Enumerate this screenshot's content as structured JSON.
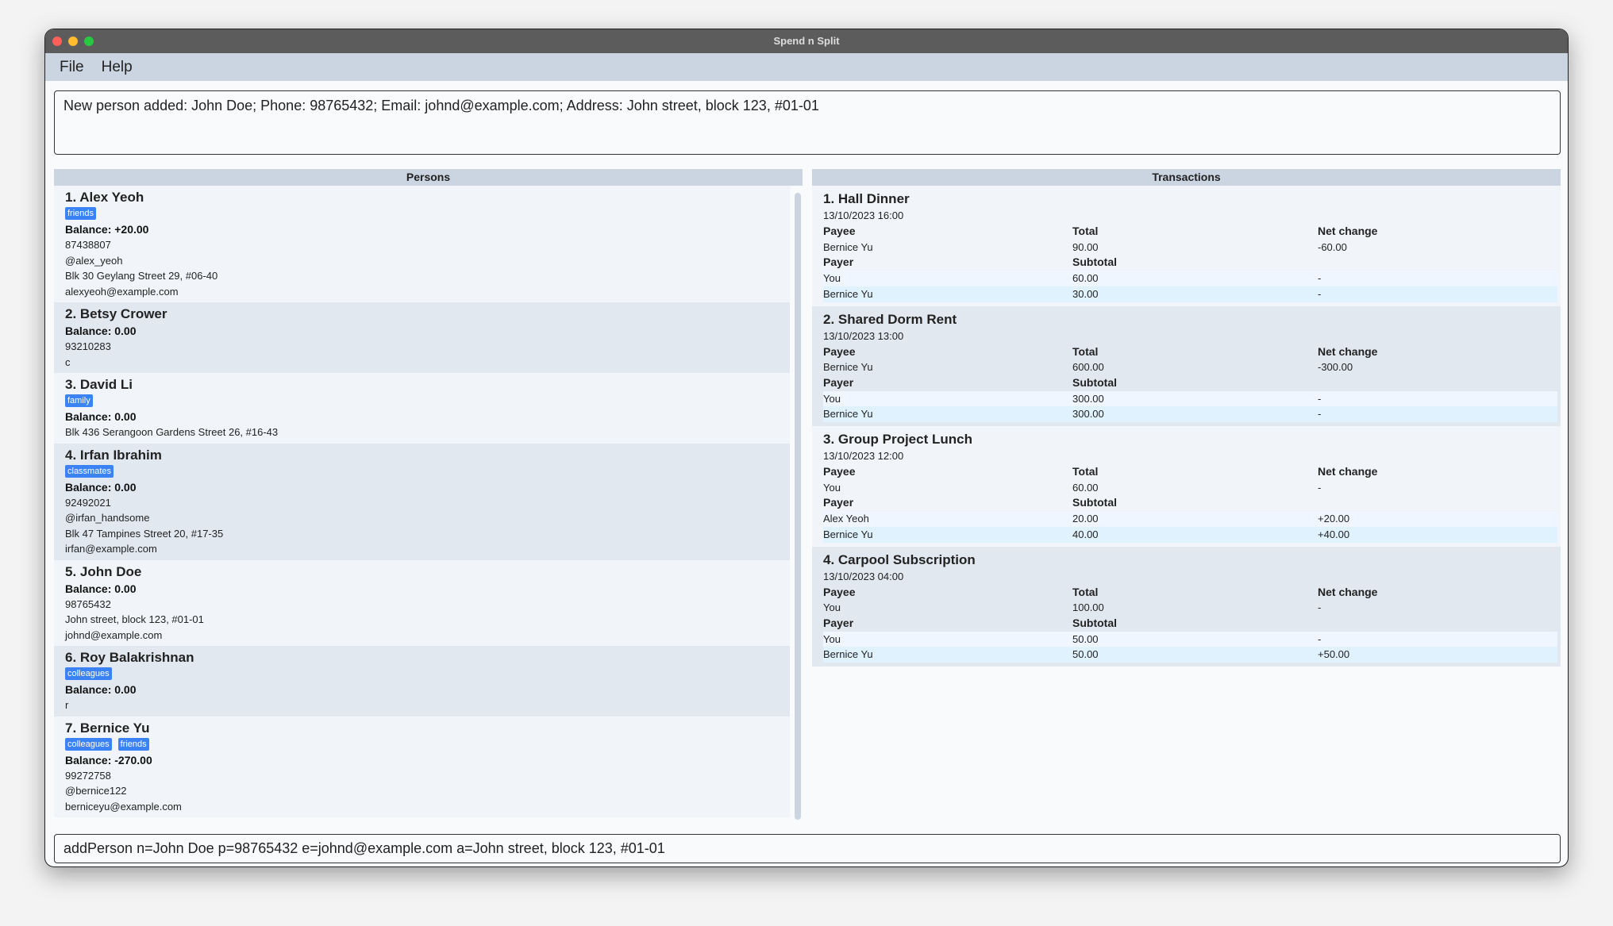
{
  "window": {
    "title": "Spend n Split"
  },
  "menu": [
    "File",
    "Help"
  ],
  "result": "New person added: John Doe; Phone: 98765432; Email: johnd@example.com; Address: John street, block 123, #01-01",
  "persons": {
    "header": "Persons",
    "items": [
      {
        "name": "1.  Alex Yeoh",
        "tags": [
          "friends"
        ],
        "balance": "Balance: +20.00",
        "lines": [
          "87438807",
          "@alex_yeoh",
          "Blk 30 Geylang Street 29, #06-40",
          "alexyeoh@example.com"
        ]
      },
      {
        "name": "2.  Betsy Crower",
        "tags": [],
        "balance": "Balance: 0.00",
        "lines": [
          "93210283",
          "c"
        ]
      },
      {
        "name": "3.  David Li",
        "tags": [
          "family"
        ],
        "balance": "Balance: 0.00",
        "lines": [
          "Blk 436 Serangoon Gardens Street 26, #16-43"
        ]
      },
      {
        "name": "4.  Irfan Ibrahim",
        "tags": [
          "classmates"
        ],
        "balance": "Balance: 0.00",
        "lines": [
          "92492021",
          "@irfan_handsome",
          "Blk 47 Tampines Street 20, #17-35",
          "irfan@example.com"
        ]
      },
      {
        "name": "5.  John Doe",
        "tags": [],
        "balance": "Balance: 0.00",
        "lines": [
          "98765432",
          "John street, block 123, #01-01",
          "johnd@example.com"
        ]
      },
      {
        "name": "6.  Roy Balakrishnan",
        "tags": [
          "colleagues"
        ],
        "balance": "Balance: 0.00",
        "lines": [
          "r"
        ]
      },
      {
        "name": "7.  Bernice Yu",
        "tags": [
          "colleagues",
          "friends"
        ],
        "balance": "Balance: -270.00",
        "lines": [
          "99272758",
          "@bernice122",
          "berniceyu@example.com"
        ]
      }
    ]
  },
  "transactions": {
    "header": "Transactions",
    "labels": {
      "payee": "Payee",
      "total": "Total",
      "net": "Net change",
      "payer": "Payer",
      "subtotal": "Subtotal"
    },
    "items": [
      {
        "title": "1.  Hall Dinner",
        "date": "13/10/2023 16:00",
        "payee": [
          "Bernice Yu",
          "90.00",
          "-60.00"
        ],
        "payers": [
          [
            "You",
            "60.00",
            "-"
          ],
          [
            "Bernice Yu",
            "30.00",
            "-"
          ]
        ]
      },
      {
        "title": "2.  Shared Dorm Rent",
        "date": "13/10/2023 13:00",
        "payee": [
          "Bernice Yu",
          "600.00",
          "-300.00"
        ],
        "payers": [
          [
            "You",
            "300.00",
            "-"
          ],
          [
            "Bernice Yu",
            "300.00",
            "-"
          ]
        ]
      },
      {
        "title": "3.  Group Project Lunch",
        "date": "13/10/2023 12:00",
        "payee": [
          "You",
          "60.00",
          "-"
        ],
        "payers": [
          [
            "Alex Yeoh",
            "20.00",
            "+20.00"
          ],
          [
            "Bernice Yu",
            "40.00",
            "+40.00"
          ]
        ]
      },
      {
        "title": "4.  Carpool Subscription",
        "date": "13/10/2023 04:00",
        "payee": [
          "You",
          "100.00",
          "-"
        ],
        "payers": [
          [
            "You",
            "50.00",
            "-"
          ],
          [
            "Bernice Yu",
            "50.00",
            "+50.00"
          ]
        ]
      }
    ]
  },
  "command": "addPerson n=John Doe p=98765432 e=johnd@example.com a=John street, block 123, #01-01",
  "colors": {
    "tag": "#3b82f6",
    "menubar": "#cbd5e1",
    "titlebar": "#5c5c5c"
  }
}
